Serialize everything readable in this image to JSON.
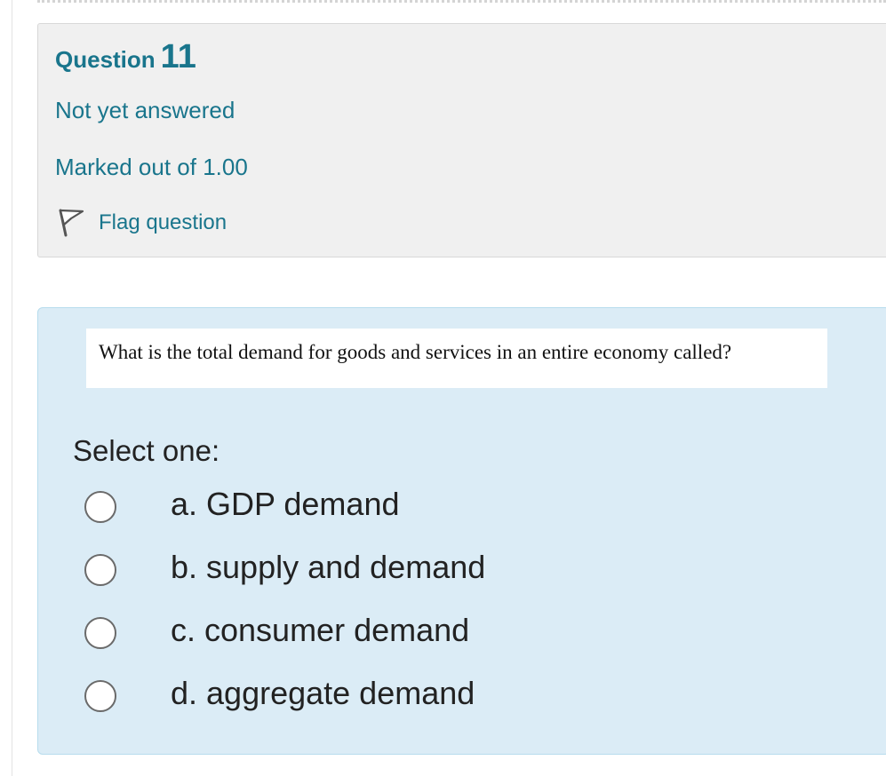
{
  "question_info": {
    "question_word": "Question",
    "question_number": "11",
    "state": "Not yet answered",
    "grade": "Marked out of 1.00",
    "flag_label": "Flag question",
    "flag_icon": "flag-icon"
  },
  "question": {
    "text": "What is the total demand for goods and services in an entire economy called?",
    "prompt": "Select one:",
    "options": [
      {
        "label": "a. GDP demand",
        "selected": false
      },
      {
        "label": "b. supply and demand",
        "selected": false
      },
      {
        "label": "c. consumer demand",
        "selected": false
      },
      {
        "label": "d. aggregate demand",
        "selected": false
      }
    ]
  },
  "colors": {
    "accent": "#19758c",
    "info_background": "#f0f0f0",
    "content_background": "#dbecf6"
  }
}
